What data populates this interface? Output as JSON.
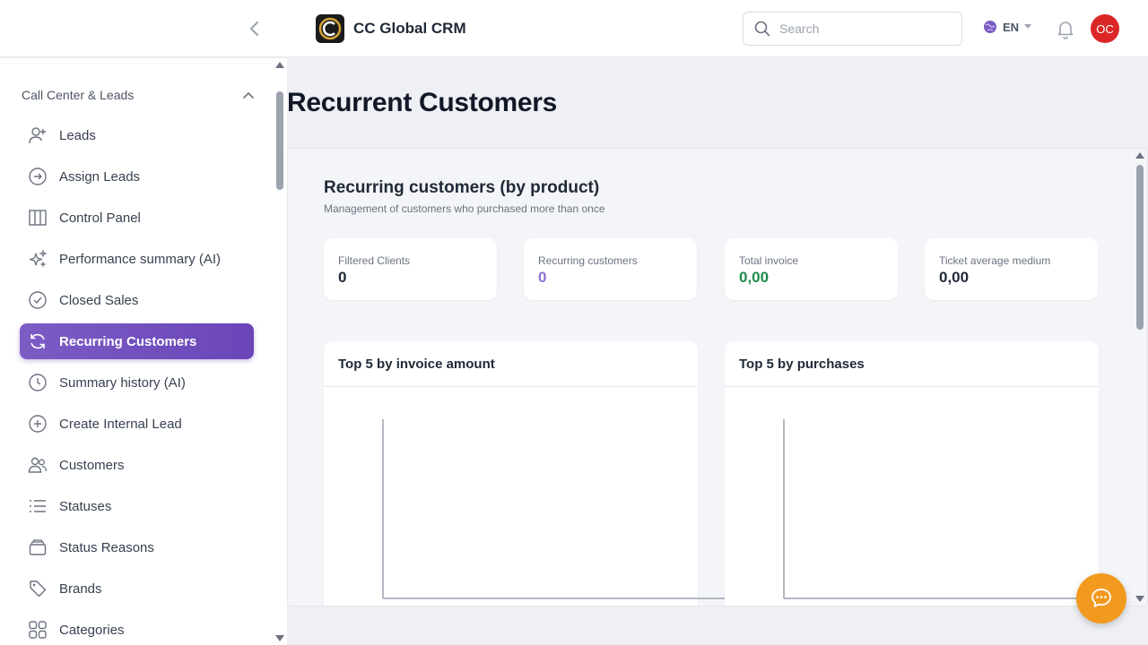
{
  "header": {
    "app_title": "CC Global CRM",
    "search_placeholder": "Search",
    "language": "EN",
    "avatar_initials": "OC"
  },
  "sidebar": {
    "section_label": "Call Center & Leads",
    "items": [
      {
        "label": "Leads",
        "icon": "user-plus-icon"
      },
      {
        "label": "Assign Leads",
        "icon": "arrow-circle-icon"
      },
      {
        "label": "Control Panel",
        "icon": "columns-icon"
      },
      {
        "label": "Performance summary (AI)",
        "icon": "sparkles-icon"
      },
      {
        "label": "Closed Sales",
        "icon": "check-circle-icon"
      },
      {
        "label": "Recurring Customers",
        "icon": "refresh-icon",
        "active": true
      },
      {
        "label": "Summary history (AI)",
        "icon": "clock-icon"
      },
      {
        "label": "Create Internal Lead",
        "icon": "plus-circle-icon"
      },
      {
        "label": "Customers",
        "icon": "users-icon"
      },
      {
        "label": "Statuses",
        "icon": "list-icon"
      },
      {
        "label": "Status Reasons",
        "icon": "archive-icon"
      },
      {
        "label": "Brands",
        "icon": "tag-icon"
      },
      {
        "label": "Categories",
        "icon": "grid-icon"
      }
    ]
  },
  "main": {
    "page_title": "Recurrent Customers",
    "panel_title": "Recurring customers (by product)",
    "panel_subtitle": "Management of customers who purchased more than once",
    "kpis": [
      {
        "label": "Filtered Clients",
        "value": "0",
        "color": "#1f2937"
      },
      {
        "label": "Recurring customers",
        "value": "0",
        "color": "#8b6fd0"
      },
      {
        "label": "Total invoice",
        "value": "0,00",
        "color": "#1f8a4c"
      },
      {
        "label": "Ticket average medium",
        "value": "0,00",
        "color": "#1f2937"
      }
    ],
    "charts": [
      {
        "title": "Top 5 by invoice amount"
      },
      {
        "title": "Top 5 by purchases"
      }
    ]
  },
  "colors": {
    "accent": "#6a45b8",
    "avatar": "#dc2626",
    "chat_fab": "#f29a1f"
  }
}
